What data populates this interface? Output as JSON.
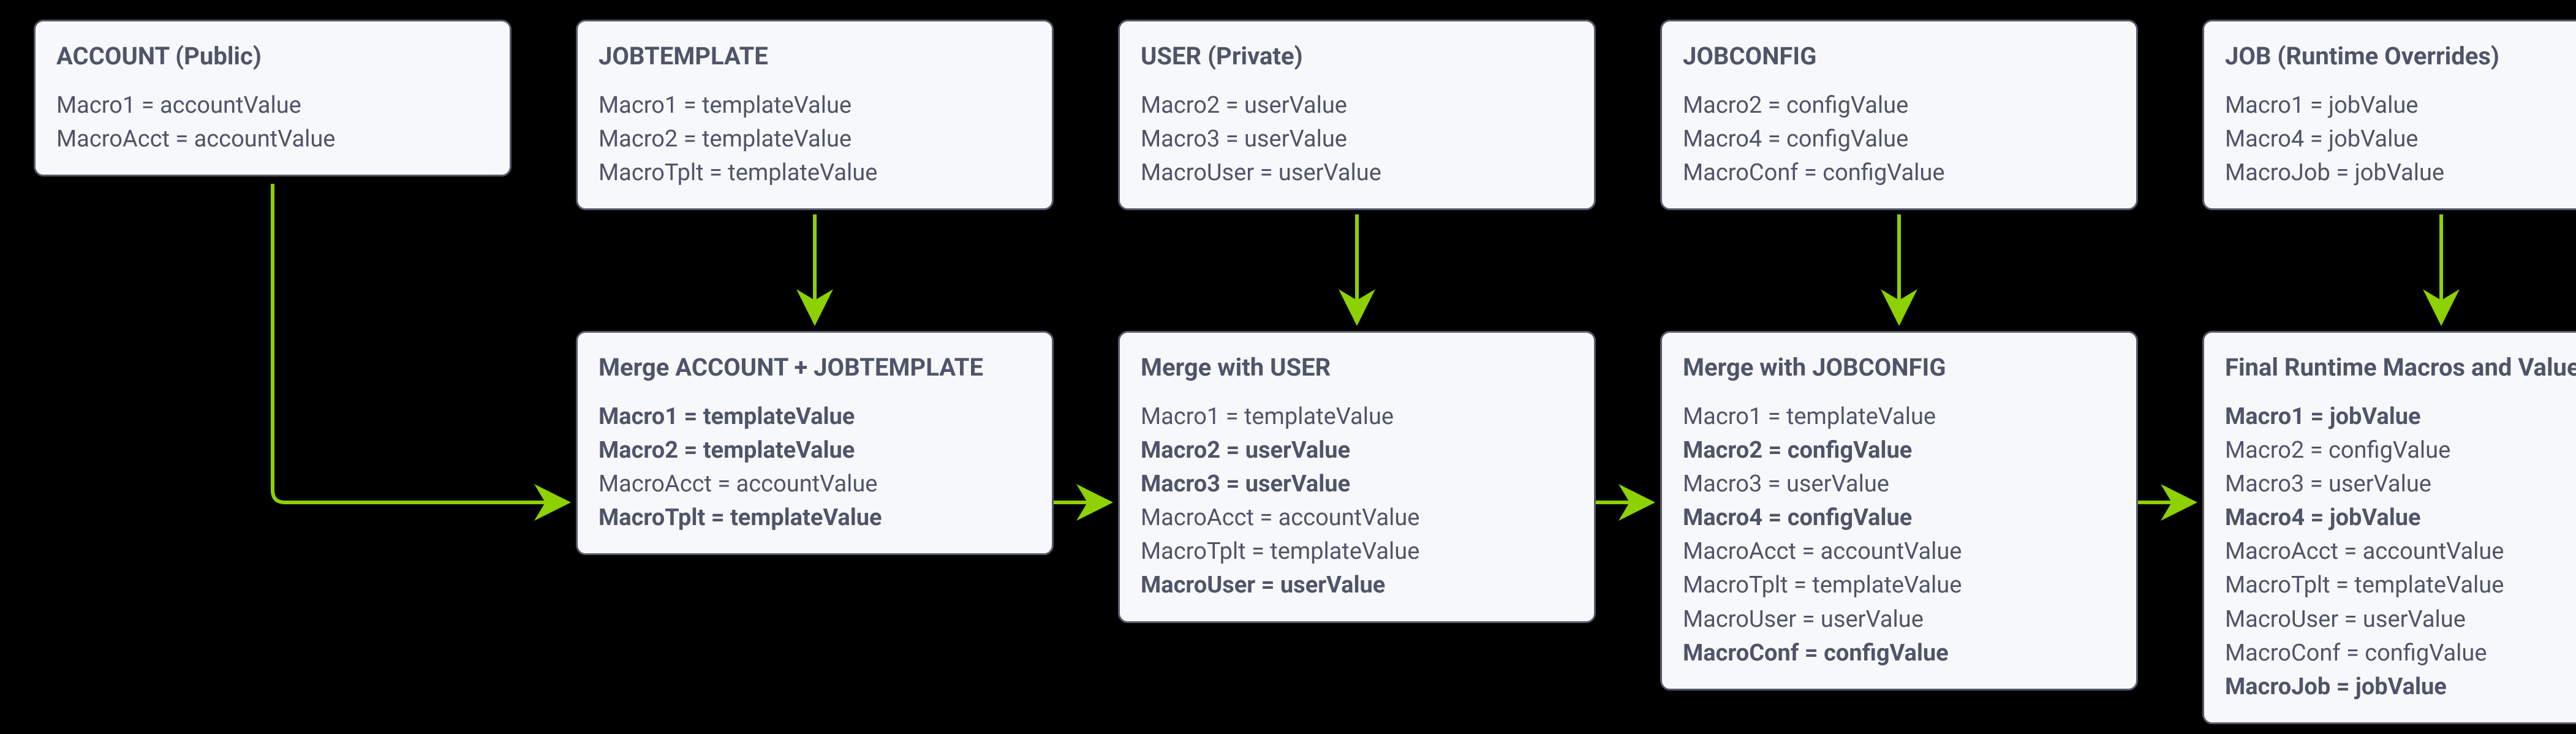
{
  "nodes": {
    "account": {
      "title": "ACCOUNT (Public)",
      "lines": [
        {
          "text": "Macro1 = accountValue",
          "bold": false
        },
        {
          "text": "MacroAcct = accountValue",
          "bold": false
        }
      ]
    },
    "jobtemplate": {
      "title": "JOBTEMPLATE",
      "lines": [
        {
          "text": "Macro1 = templateValue",
          "bold": false
        },
        {
          "text": "Macro2 = templateValue",
          "bold": false
        },
        {
          "text": "MacroTplt = templateValue",
          "bold": false
        }
      ]
    },
    "user": {
      "title": "USER (Private)",
      "lines": [
        {
          "text": "Macro2 = userValue",
          "bold": false
        },
        {
          "text": "Macro3 = userValue",
          "bold": false
        },
        {
          "text": "MacroUser = userValue",
          "bold": false
        }
      ]
    },
    "jobconfig": {
      "title": "JOBCONFIG",
      "lines": [
        {
          "text": "Macro2 = configValue",
          "bold": false
        },
        {
          "text": "Macro4 = configValue",
          "bold": false
        },
        {
          "text": "MacroConf = configValue",
          "bold": false
        }
      ]
    },
    "job": {
      "title": "JOB (Runtime Overrides)",
      "lines": [
        {
          "text": "Macro1 = jobValue",
          "bold": false
        },
        {
          "text": "Macro4 = jobValue",
          "bold": false
        },
        {
          "text": "MacroJob = jobValue",
          "bold": false
        }
      ]
    },
    "merge1": {
      "title": "Merge ACCOUNT + JOBTEMPLATE",
      "lines": [
        {
          "text": "Macro1 = templateValue",
          "bold": true
        },
        {
          "text": "Macro2 = templateValue",
          "bold": true
        },
        {
          "text": "MacroAcct = accountValue",
          "bold": false
        },
        {
          "text": "MacroTplt = templateValue",
          "bold": true
        }
      ]
    },
    "merge2": {
      "title": "Merge with USER",
      "lines": [
        {
          "text": "Macro1 = templateValue",
          "bold": false
        },
        {
          "text": "Macro2 = userValue",
          "bold": true
        },
        {
          "text": "Macro3 = userValue",
          "bold": true
        },
        {
          "text": "MacroAcct = accountValue",
          "bold": false
        },
        {
          "text": "MacroTplt = templateValue",
          "bold": false
        },
        {
          "text": "MacroUser = userValue",
          "bold": true
        }
      ]
    },
    "merge3": {
      "title": "Merge with JOBCONFIG",
      "lines": [
        {
          "text": "Macro1 = templateValue",
          "bold": false
        },
        {
          "text": "Macro2 = configValue",
          "bold": true
        },
        {
          "text": "Macro3 = userValue",
          "bold": false
        },
        {
          "text": "Macro4 = configValue",
          "bold": true
        },
        {
          "text": "MacroAcct = accountValue",
          "bold": false
        },
        {
          "text": "MacroTplt = templateValue",
          "bold": false
        },
        {
          "text": "MacroUser = userValue",
          "bold": false
        },
        {
          "text": "MacroConf = configValue",
          "bold": true
        }
      ]
    },
    "merge4": {
      "title": "Final Runtime Macros and Values",
      "lines": [
        {
          "text": "Macro1 = jobValue",
          "bold": true
        },
        {
          "text": "Macro2 = configValue",
          "bold": false
        },
        {
          "text": "Macro3 = userValue",
          "bold": false
        },
        {
          "text": "Macro4 = jobValue",
          "bold": true
        },
        {
          "text": "MacroAcct = accountValue",
          "bold": false
        },
        {
          "text": "MacroTplt = templateValue",
          "bold": false
        },
        {
          "text": "MacroUser = userValue",
          "bold": false
        },
        {
          "text": "MacroConf = configValue",
          "bold": false
        },
        {
          "text": "MacroJob = jobValue",
          "bold": true
        }
      ]
    }
  }
}
